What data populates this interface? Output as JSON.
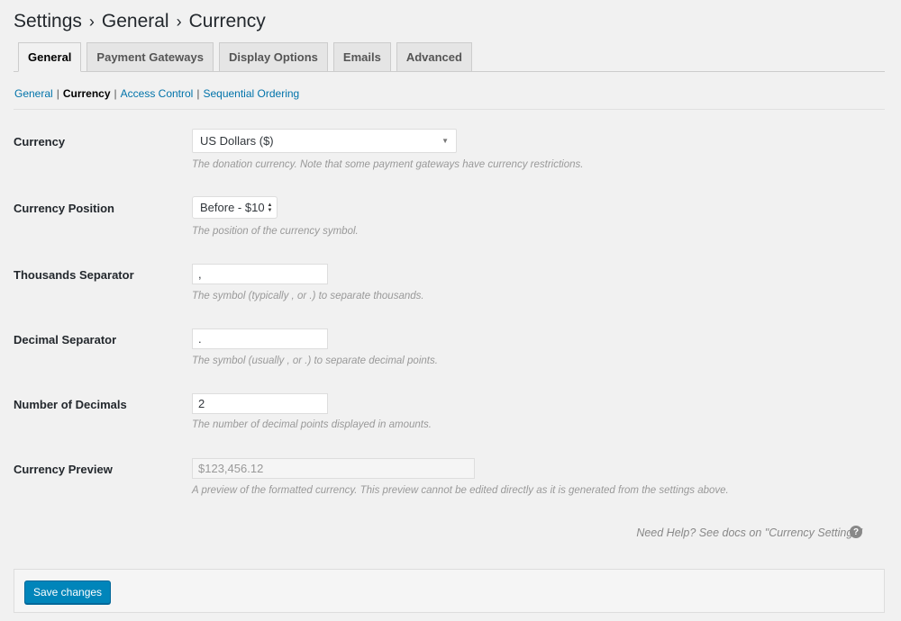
{
  "breadcrumb": {
    "items": [
      "Settings",
      "General",
      "Currency"
    ],
    "separator": "›"
  },
  "tabs": [
    {
      "label": "General",
      "active": true
    },
    {
      "label": "Payment Gateways",
      "active": false
    },
    {
      "label": "Display Options",
      "active": false
    },
    {
      "label": "Emails",
      "active": false
    },
    {
      "label": "Advanced",
      "active": false
    }
  ],
  "subnav": {
    "items": [
      "General",
      "Currency",
      "Access Control",
      "Sequential Ordering"
    ],
    "separator": "|"
  },
  "settings": {
    "currency": {
      "label": "Currency",
      "value": "US Dollars ($)",
      "desc": "The donation currency. Note that some payment gateways have currency restrictions."
    },
    "position": {
      "label": "Currency Position",
      "value": "Before - $10",
      "desc": "The position of the currency symbol."
    },
    "thousands": {
      "label": "Thousands Separator",
      "value": ",",
      "desc": "The symbol (typically , or .) to separate thousands."
    },
    "decimal": {
      "label": "Decimal Separator",
      "value": ".",
      "desc": "The symbol (usually , or .) to separate decimal points."
    },
    "decimals": {
      "label": "Number of Decimals",
      "value": "2",
      "desc": "The number of decimal points displayed in amounts."
    },
    "preview": {
      "label": "Currency Preview",
      "value": "$123,456.12",
      "desc": "A preview of the formatted currency. This preview cannot be edited directly as it is generated from the settings above."
    }
  },
  "help": {
    "text": "Need Help? See docs on \"Currency Settings\"",
    "icon": "question-circle-icon"
  },
  "save": {
    "label": "Save changes"
  },
  "colors": {
    "accent": "#0085ba",
    "link": "#0073aa"
  }
}
